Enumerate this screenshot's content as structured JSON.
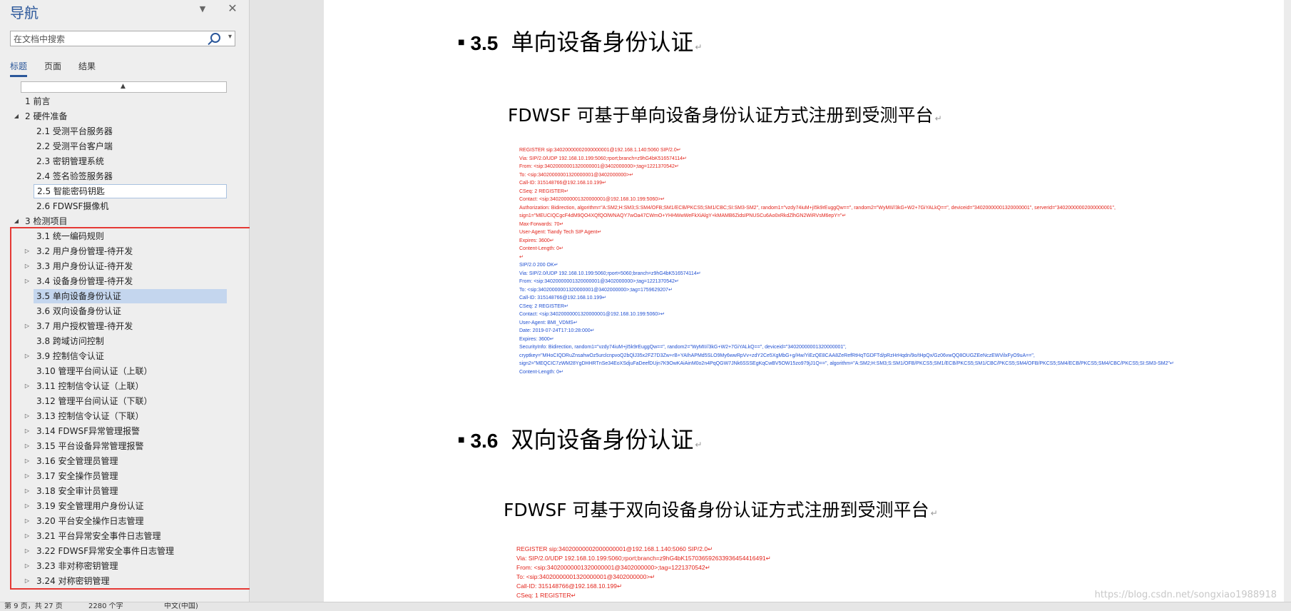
{
  "nav": {
    "title": "导航",
    "dropdown_glyph": "▼",
    "close_glyph": "✕",
    "search_placeholder": "在文档中搜索",
    "search_caret": "▾",
    "tabs": [
      "标题",
      "页面",
      "结果"
    ],
    "collapse_glyph": "▲",
    "items": [
      {
        "label": "1 前言",
        "level": 1,
        "toggle": ""
      },
      {
        "label": "2 硬件准备",
        "level": 1,
        "toggle": "◢"
      },
      {
        "label": "2.1 受测平台服务器",
        "level": 2,
        "toggle": ""
      },
      {
        "label": "2.2 受测平台客户端",
        "level": 2,
        "toggle": ""
      },
      {
        "label": "2.3 密钥管理系统",
        "level": 2,
        "toggle": ""
      },
      {
        "label": "2.4 签名验签服务器",
        "level": 2,
        "toggle": ""
      },
      {
        "label": "2.5 智能密码钥匙",
        "level": 2,
        "toggle": "",
        "hovered": true
      },
      {
        "label": "2.6 FDWSF摄像机",
        "level": 2,
        "toggle": ""
      },
      {
        "label": "3 检测项目",
        "level": 1,
        "toggle": "◢"
      },
      {
        "label": "3.1 统一编码规则",
        "level": 2,
        "toggle": ""
      },
      {
        "label": "3.2 用户身份管理-待开发",
        "level": 2,
        "toggle": "▷"
      },
      {
        "label": "3.3 用户身份认证-待开发",
        "level": 2,
        "toggle": "▷"
      },
      {
        "label": "3.4 设备身份管理-待开发",
        "level": 2,
        "toggle": "▷"
      },
      {
        "label": "3.5 单向设备身份认证",
        "level": 2,
        "toggle": "",
        "selected": true
      },
      {
        "label": "3.6 双向设备身份认证",
        "level": 2,
        "toggle": ""
      },
      {
        "label": "3.7 用户授权管理-待开发",
        "level": 2,
        "toggle": "▷"
      },
      {
        "label": "3.8 跨域访问控制",
        "level": 2,
        "toggle": ""
      },
      {
        "label": "3.9 控制信令认证",
        "level": 2,
        "toggle": "▷"
      },
      {
        "label": "3.10 管理平台间认证（上联）",
        "level": 2,
        "toggle": ""
      },
      {
        "label": "3.11 控制信令认证（上联）",
        "level": 2,
        "toggle": "▷"
      },
      {
        "label": "3.12 管理平台间认证（下联）",
        "level": 2,
        "toggle": ""
      },
      {
        "label": "3.13 控制信令认证（下联）",
        "level": 2,
        "toggle": "▷"
      },
      {
        "label": "3.14 FDWSF异常管理报警",
        "level": 2,
        "toggle": "▷"
      },
      {
        "label": "3.15 平台设备异常管理报警",
        "level": 2,
        "toggle": "▷"
      },
      {
        "label": "3.16 安全管理员管理",
        "level": 2,
        "toggle": "▷"
      },
      {
        "label": "3.17 安全操作员管理",
        "level": 2,
        "toggle": "▷"
      },
      {
        "label": "3.18 安全审计员管理",
        "level": 2,
        "toggle": "▷"
      },
      {
        "label": "3.19 安全管理用户身份认证",
        "level": 2,
        "toggle": "▷"
      },
      {
        "label": "3.20 平台安全操作日志管理",
        "level": 2,
        "toggle": "▷"
      },
      {
        "label": "3.21 平台异常安全事件日志管理",
        "level": 2,
        "toggle": "▷"
      },
      {
        "label": "3.22 FDWSF异常安全事件日志管理",
        "level": 2,
        "toggle": "▷"
      },
      {
        "label": "3.23 非对称密钥管理",
        "level": 2,
        "toggle": "▷"
      },
      {
        "label": "3.24 对称密钥管理",
        "level": 2,
        "toggle": "▷"
      }
    ]
  },
  "doc": {
    "para_mark": "↵",
    "bullet": "■",
    "h35": {
      "num": "3.5",
      "text": "单向设备身份认证"
    },
    "p35": "FDWSF 可基于单向设备身份认证方式注册到受测平台",
    "code1": [
      {
        "t": "REGISTER sip:34020000002000000001@192.168.1.140:5060 SIP/2.0↵",
        "c": "red"
      },
      {
        "t": "Via: SIP/2.0/UDP 192.168.10.199:5060;rport;branch=z9hG4bK516574114↵",
        "c": "red"
      },
      {
        "t": "From: <sip:34020000001320000001@3402000000>;tag=1221370542↵",
        "c": "red"
      },
      {
        "t": "To: <sip:34020000001320000001@3402000000>↵",
        "c": "red"
      },
      {
        "t": "Call-ID: 315148766@192.168.10.199↵",
        "c": "red"
      },
      {
        "t": "CSeq: 2 REGISTER↵",
        "c": "red"
      },
      {
        "t": "Contact: <sip:34020000001320000001@192.168.10.199:5060>↵",
        "c": "red"
      },
      {
        "t": "Authorization: Bidirection, algorithm=\"A:SM2;H:SM3;S:SM4/OFB;SM1/ECB/PKCS5;SM1/CBC;SI:SM3-SM2\", random1=\"vzdy74iuM+jI5k9rEuggQw==\", random2=\"WyMII//3kG+W2+7GiYALkQ==\", deviceid=\"34020000001320000001\", serverid=\"34020000002000000001\",",
        "c": "red"
      },
      {
        "t": "sign1=\"MEUCIQCgcF4dM9QO4XQfQOlWNAQY7wOa47CWmO+YHHWwWeFkXiAlgY+kMAMB6ZidsIPNUSCu6Ao0xRkdZlhGN2WiRVsM6epY=\"↵",
        "c": "red"
      },
      {
        "t": "Max-Forwards: 70↵",
        "c": "red"
      },
      {
        "t": "User-Agent: Tiandy Tech SIP Agent↵",
        "c": "red"
      },
      {
        "t": "Expires: 3600↵",
        "c": "red"
      },
      {
        "t": "Content-Length: 0↵",
        "c": "red"
      },
      {
        "t": "↵",
        "c": "red"
      },
      {
        "t": "SIP/2.0 200 OK↵",
        "c": "blue"
      },
      {
        "t": "Via: SIP/2.0/UDP 192.168.10.199:5060;rport=5060;branch=z9hG4bK516574114↵",
        "c": "blue"
      },
      {
        "t": "From: <sip:34020000001320000001@3402000000>;tag=1221370542↵",
        "c": "blue"
      },
      {
        "t": "To: <sip:34020000001320000001@3402000000>;tag=1759629207↵",
        "c": "blue"
      },
      {
        "t": "Call-ID: 315148766@192.168.10.199↵",
        "c": "blue"
      },
      {
        "t": "CSeq: 2 REGISTER↵",
        "c": "blue"
      },
      {
        "t": "Contact: <sip:34020000001320000001@192.168.10.199:5060>↵",
        "c": "blue"
      },
      {
        "t": "User-Agent: BMI_VDMS↵",
        "c": "blue"
      },
      {
        "t": "Date: 2019-07-24T17:10:28:000↵",
        "c": "blue"
      },
      {
        "t": "Expires: 3600↵",
        "c": "blue"
      },
      {
        "t": "SecurityInfo: Bidirection, random1=\"vzdy74iuM+jI5k9rEuggQw==\", random2=\"WyMII//3kG+W2+7GiYALkQ==\", deviceid=\"34020000001320000001\",",
        "c": "blue"
      },
      {
        "t": "cryptkey=\"MHoCIQDRuZnsahwOz5urclcnpvoQ2bQlJ35x2FZ7D3Zw+rB+YAIhAPMd5SLO9My6wwRpVv+zdY2Ce5XgMbG+g/Hw/YiEzQE8CAA8ZeRefRtHqTGDFTd/pRzHrHqdn/9o/tHpQx/Gz06vwQQ8OUGZEeNczEWVilxFyO9uA==\",",
        "c": "blue"
      },
      {
        "t": "sign2=\"MEQCIC7zWM28YgDHHRTnSe34EoXSdjuFaDeefDUjn7K9OwKAiAinM0o2n4PqQGW7JNk6SSSEgKqCwBV5OW15zo979jJ1Q==\", algorithm=\"A:SM2;H:SM3;S:SM1/OFB/PKCS5;SM1/ECB/PKCS5;SM1/CBC/PKCS5;SM4/OFB/PKCS5;SM4/ECB/PKCS5;SM4/CBC/PKCS5;SI:SM3-SM2\"↵",
        "c": "blue"
      },
      {
        "t": "Content-Length: 0↵",
        "c": "blue"
      }
    ],
    "h36": {
      "num": "3.6",
      "text": "双向设备身份认证"
    },
    "p36": "FDWSF 可基于双向设备身份认证方式注册到受测平台",
    "code2": [
      {
        "t": "REGISTER sip:34020000002000000001@192.168.1.140:5060 SIP/2.0↵",
        "c": "red"
      },
      {
        "t": "Via: SIP/2.0/UDP 192.168.10.199:5060;rport;branch=z9hG4bK157036592633936454416491↵",
        "c": "red"
      },
      {
        "t": "From: <sip:34020000001320000001@3402000000>;tag=1221370542↵",
        "c": "red"
      },
      {
        "t": "To: <sip:34020000001320000001@3402000000>↵",
        "c": "red"
      },
      {
        "t": "Call-ID: 315148766@192.168.10.199↵",
        "c": "red"
      },
      {
        "t": "CSeq: 1 REGISTER↵",
        "c": "red"
      }
    ]
  },
  "status": {
    "page": "第 9 页，共 27 页",
    "words": "2280 个字",
    "lang": "中文(中国)"
  },
  "watermark": "https://blog.csdn.net/songxiao1988918"
}
